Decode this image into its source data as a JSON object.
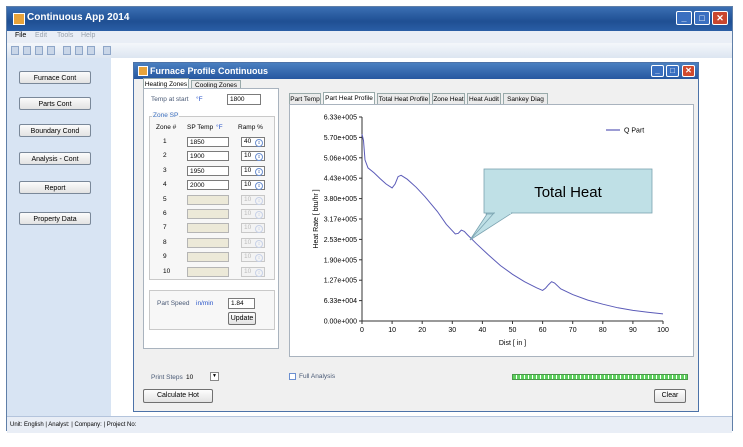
{
  "app": {
    "title": "Continuous App 2014",
    "menu": [
      "File",
      "Edit",
      "Tools",
      "Help"
    ],
    "status": "Unit: English  |  Analyst:    |  Company:    |  Project No:"
  },
  "nav": {
    "items": [
      "Furnace Cont",
      "Parts Cont",
      "Boundary Cond",
      "Analysis - Cont",
      "Report",
      "Property Data"
    ]
  },
  "child": {
    "title": "Furnace Profile Continuous",
    "left_tabs": [
      "Heating Zones",
      "Cooling Zones"
    ],
    "temp_at_start_label": "Temp at start",
    "temp_unit": "°F",
    "temp_at_start_value": "1800",
    "zone_sp_title": "Zone SP",
    "zone_header": "Zone #",
    "sp_temp_header": "SP Temp",
    "ramp_header": "Ramp %",
    "zones": [
      {
        "num": "1",
        "sp": "1850",
        "ramp": "40"
      },
      {
        "num": "2",
        "sp": "1900",
        "ramp": "10"
      },
      {
        "num": "3",
        "sp": "1950",
        "ramp": "10"
      },
      {
        "num": "4",
        "sp": "2000",
        "ramp": "10"
      },
      {
        "num": "5",
        "sp": "",
        "ramp": "10"
      },
      {
        "num": "6",
        "sp": "",
        "ramp": "10"
      },
      {
        "num": "7",
        "sp": "",
        "ramp": "10"
      },
      {
        "num": "8",
        "sp": "",
        "ramp": "10"
      },
      {
        "num": "9",
        "sp": "",
        "ramp": "10"
      },
      {
        "num": "10",
        "sp": "",
        "ramp": "10"
      }
    ],
    "part_speed_label": "Part Speed",
    "part_speed_unit": "in/min",
    "part_speed_value": "1.84",
    "update_label": "Update",
    "chart_tabs": [
      "Part Temp",
      "Part Heat Profile",
      "Total Heat Profile",
      "Zone Heat",
      "Heat Audit",
      "Sankey Diag"
    ],
    "print_steps_label": "Print Steps",
    "print_steps_value": "10",
    "full_analysis_label": "Full Analysis",
    "calculate_label": "Calculate Hot",
    "clear_label": "Clear",
    "callout_text": "Total Heat"
  },
  "chart_data": {
    "type": "line",
    "xlabel": "Dist [ in ]",
    "ylabel": "Heat Rate [ btu/hr ]",
    "xlim": [
      0,
      100
    ],
    "ylim": [
      0,
      633000
    ],
    "xticks": [
      "0",
      "10",
      "20",
      "30",
      "40",
      "50",
      "60",
      "70",
      "80",
      "90",
      "100"
    ],
    "yticks": [
      "0.00e+000",
      "6.33e+004",
      "1.27e+005",
      "1.90e+005",
      "2.53e+005",
      "3.17e+005",
      "3.80e+005",
      "4.43e+005",
      "5.06e+005",
      "5.70e+005",
      "6.33e+005"
    ],
    "legend_position": "top-right",
    "series": [
      {
        "name": "Q Part",
        "color": "#5b5bb8",
        "x": [
          0,
          0.5,
          1,
          2,
          4,
          6,
          8,
          10,
          11,
          12,
          13,
          15,
          18,
          21,
          25,
          28,
          31,
          32,
          33,
          34,
          35,
          38,
          42,
          46,
          50,
          54,
          58,
          60,
          61,
          62,
          63,
          64,
          66,
          70,
          75,
          80,
          85,
          90,
          95,
          100
        ],
        "y": [
          580000,
          560000,
          500000,
          475000,
          460000,
          442000,
          425000,
          413000,
          425000,
          448000,
          452000,
          440000,
          415000,
          385000,
          340000,
          300000,
          270000,
          272000,
          282000,
          278000,
          268000,
          240000,
          205000,
          172000,
          145000,
          122000,
          103000,
          95000,
          102000,
          113000,
          122000,
          118000,
          100000,
          82000,
          65000,
          52000,
          41000,
          33000,
          27000,
          22000
        ]
      }
    ]
  }
}
